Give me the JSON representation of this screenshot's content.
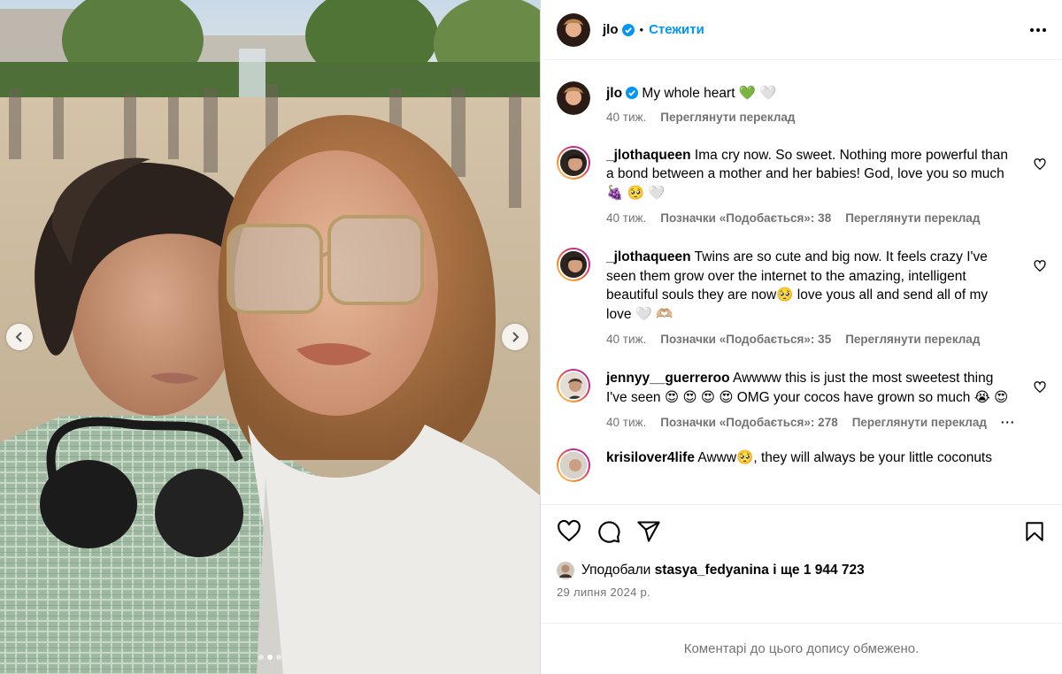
{
  "post": {
    "username": "jlo",
    "follow_label": "Стежити",
    "separator": "•"
  },
  "caption": {
    "username": "jlo",
    "text": "My whole heart 💚 🤍",
    "time": "40 тиж.",
    "translate": "Переглянути переклад"
  },
  "comments": [
    {
      "username": "_jlothaqueen",
      "text": "Ima cry now. So sweet. Nothing more powerful than a bond between a mother and her babies! God, love you so much 🍇 🥺 🤍",
      "time": "40 тиж.",
      "likes": "Позначки «Подобається»: 38",
      "translate": "Переглянути переклад"
    },
    {
      "username": "_jlothaqueen",
      "text": "Twins are so cute and big now. It feels crazy I've seen them grow over the internet to the amazing, intelligent beautiful souls they are now🥺 love yous all and send all of my love 🤍 🫶🏼",
      "time": "40 тиж.",
      "likes": "Позначки «Подобається»: 35",
      "translate": "Переглянути переклад"
    },
    {
      "username": "jennyy__guerreroo",
      "text": "Awwww this is just the most sweetest thing I've seen 😍 😍 😍 😍 OMG your cocos have grown so much 😭 😍",
      "time": "40 тиж.",
      "likes": "Позначки «Подобається»: 278",
      "translate": "Переглянути переклад"
    },
    {
      "username": "krisilover4life",
      "text": "Awww🥺, they will always be your little coconuts"
    }
  ],
  "likes_summary": {
    "prefix": "Уподобали",
    "user": "stasya_fedyanina",
    "suffix": "і ще 1 944 723"
  },
  "date": "29 липня 2024 р.",
  "comments_limited": "Коментарі до цього допису обмежено.",
  "icons": {
    "like": "heart-icon",
    "comment": "comment-icon",
    "share": "share-icon",
    "save": "bookmark-icon",
    "more": "more-icon",
    "verified": "verified-badge-icon",
    "prev": "chevron-left-icon",
    "next": "chevron-right-icon"
  },
  "colors": {
    "accent": "#0095f6",
    "muted": "#737373",
    "verified": "#0095f6"
  }
}
